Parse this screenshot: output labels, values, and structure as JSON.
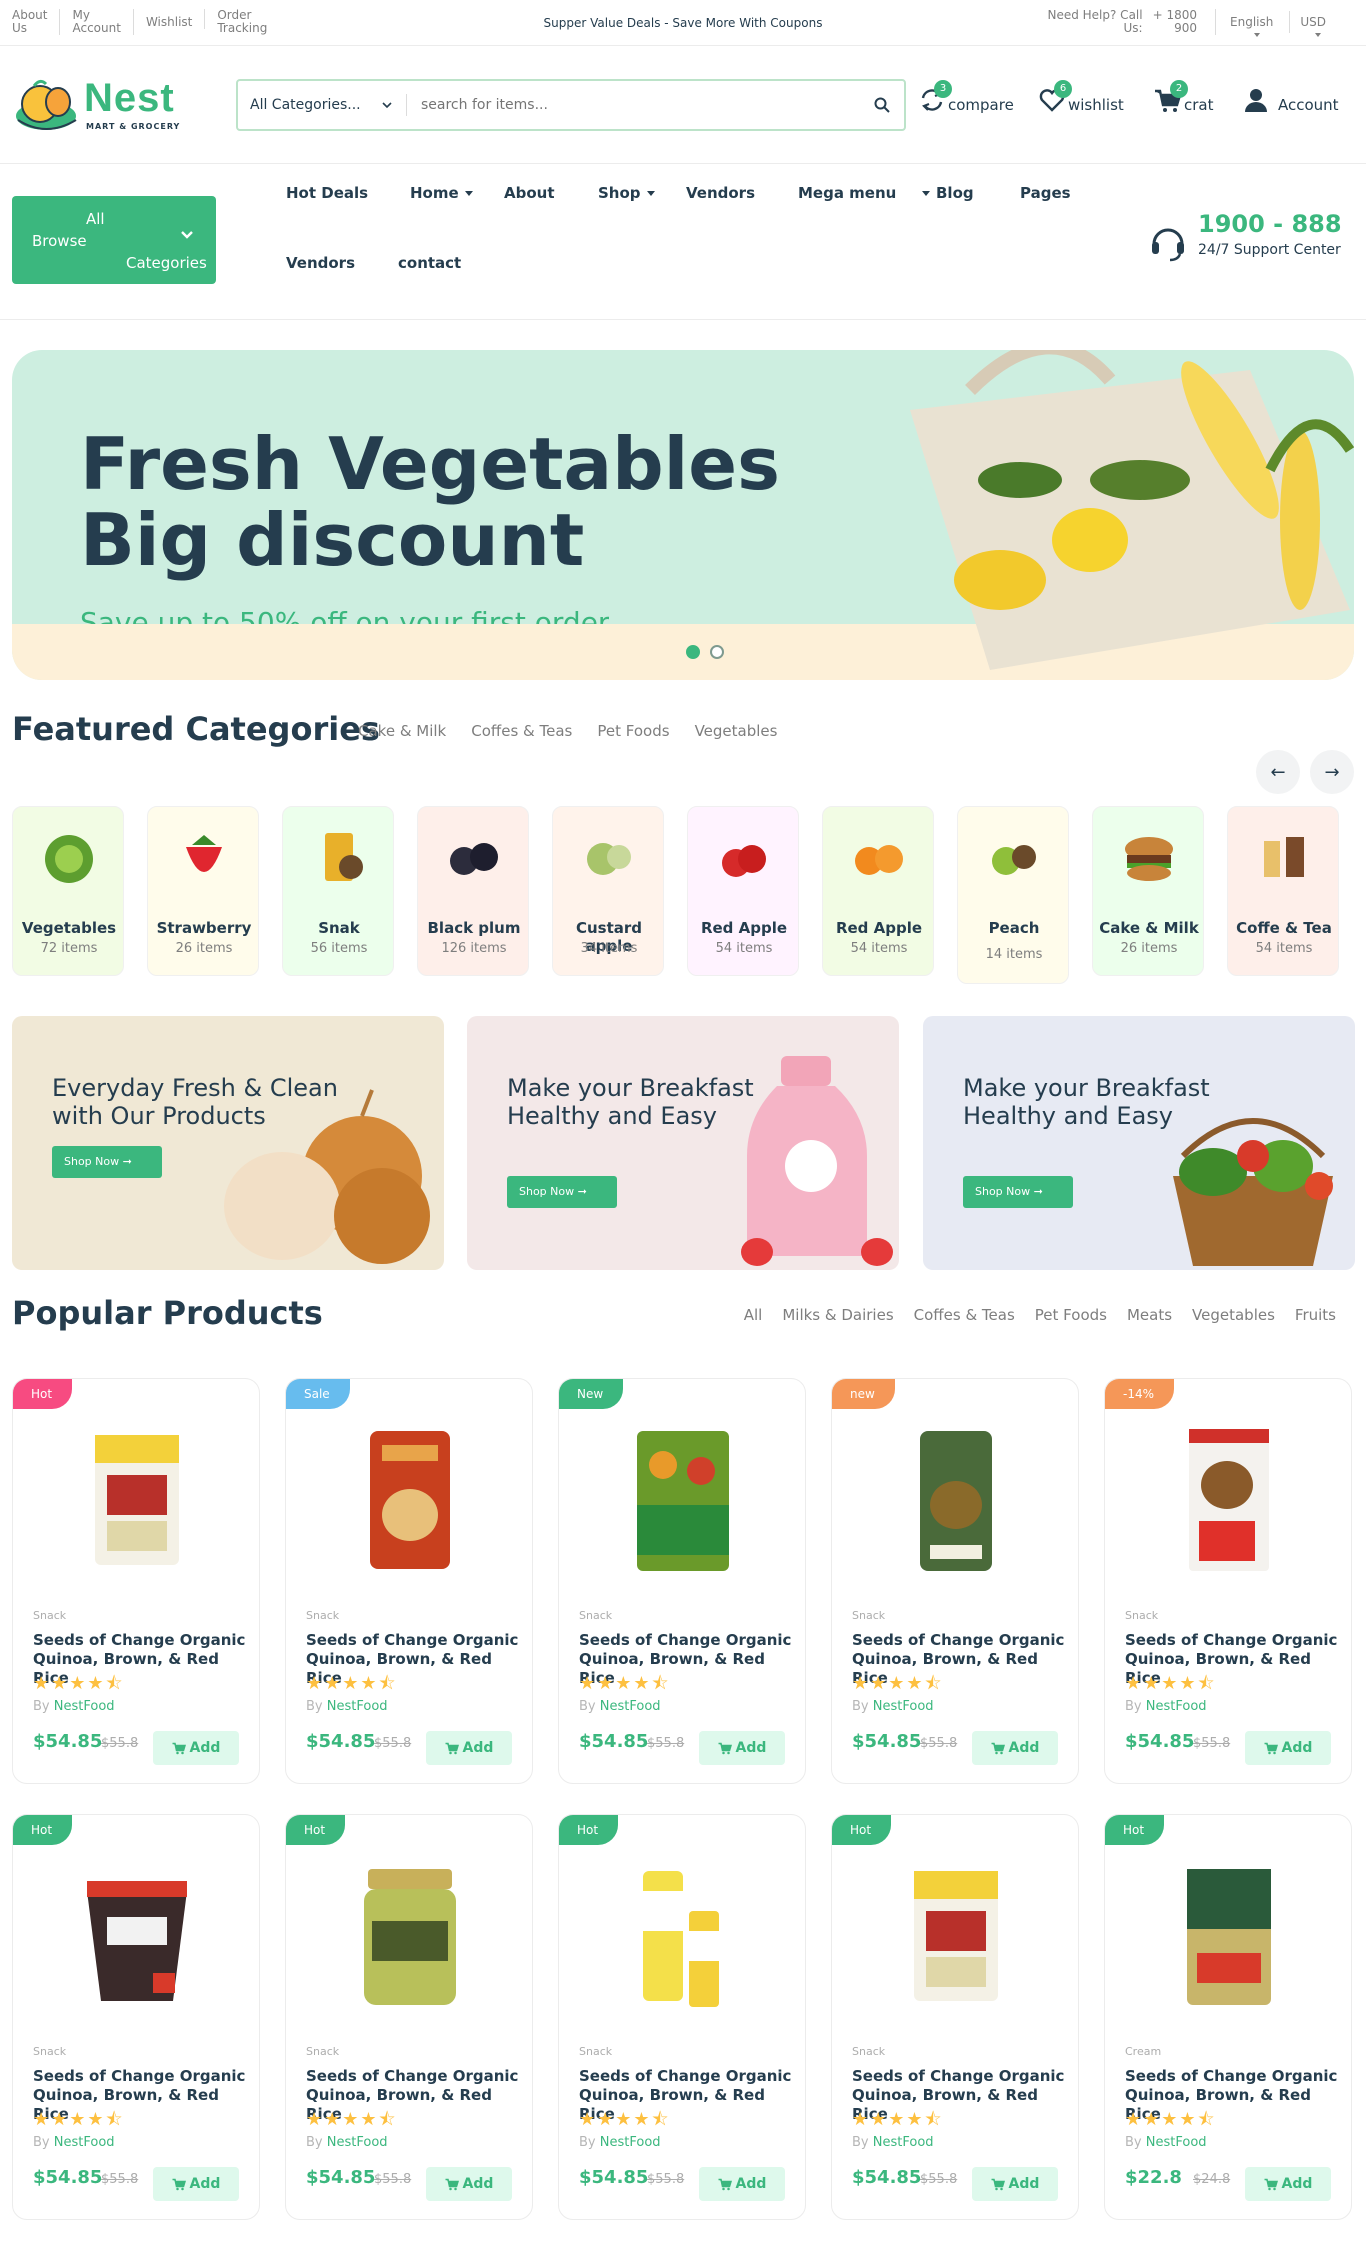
{
  "topbar": {
    "links": [
      {
        "l1": "About",
        "l2": "Us"
      },
      {
        "l1": "My",
        "l2": "Account"
      },
      {
        "l1": "Wishlist",
        "l2": ""
      },
      {
        "l1": "Order",
        "l2": "Tracking"
      }
    ],
    "promo": "Supper Value Deals - Save More With Coupons",
    "help_l1": "Need Help? Call",
    "help_l2": "Us:",
    "phone_l1": "+ 1800",
    "phone_l2": "900",
    "language": "English",
    "currency": "USD"
  },
  "header": {
    "logo_name": "Nest",
    "logo_tag": "MART & GROCERY",
    "category_select": "All Categories...",
    "search_placeholder": "search for items...",
    "compare": {
      "label": "compare",
      "count": "3"
    },
    "wishlist": {
      "label": "wishlist",
      "count": "6"
    },
    "cart": {
      "label": "crat",
      "count": "2"
    },
    "account": {
      "label": "Account"
    }
  },
  "nav": {
    "browse_l1": "All",
    "browse_l2": "Browse",
    "browse_l3": "Categories",
    "links": [
      "Hot Deals",
      "Home",
      "About",
      "Shop",
      "Vendors",
      "Mega menu",
      "Blog",
      "Pages",
      "Vendors",
      "contact"
    ],
    "support_number": "1900 - 888",
    "support_label": "24/7 Support Center"
  },
  "hero": {
    "line1": "Fresh Vegetables",
    "line2": "Big discount",
    "subtitle": "Save up to 50% off on your first order"
  },
  "featured": {
    "title": "Featured Categories",
    "tabs": [
      "Cake & Milk",
      "Coffes & Teas",
      "Pet Foods",
      "Vegetables"
    ],
    "prev_arrow": "←",
    "next_arrow": "→",
    "categories": [
      {
        "name": "Vegetables",
        "count": "72 items",
        "bg": "#f2fce4",
        "icon": "cabbage"
      },
      {
        "name": "Strawberry",
        "count": "26 items",
        "bg": "#fffceb",
        "icon": "strawberry"
      },
      {
        "name": "Snak",
        "count": "56 items",
        "bg": "#ecffec",
        "icon": "snack"
      },
      {
        "name": "Black plum",
        "count": "126 items",
        "bg": "#feefea",
        "icon": "plum"
      },
      {
        "name": "Custard apple",
        "count": "34 items",
        "bg": "#fff3eb",
        "icon": "custard-apple"
      },
      {
        "name": "Red Apple",
        "count": "54 items",
        "bg": "#fff3ff",
        "icon": "apple"
      },
      {
        "name": "Red Apple",
        "count": "54 items",
        "bg": "#f2fce4",
        "icon": "orange"
      },
      {
        "name": "Peach",
        "count": "14 items",
        "bg": "#fffceb",
        "icon": "kiwi"
      },
      {
        "name": "Cake & Milk",
        "count": "26 items",
        "bg": "#ecffec",
        "icon": "burger"
      },
      {
        "name": "Coffe & Tea",
        "count": "54 items",
        "bg": "#feefea",
        "icon": "coffee"
      }
    ]
  },
  "banners": [
    {
      "line1": "Everyday Fresh & Clean",
      "line2": "with Our Products",
      "button": "Shop Now ➞",
      "bg": "#f0e8d5"
    },
    {
      "line1": "Make your Breakfast",
      "line2": "Healthy and Easy",
      "button": "Shop Now ➞",
      "bg": "#f3e8e8"
    },
    {
      "line1": "Make your Breakfast",
      "line2": "Healthy and Easy",
      "button": "Shop Now ➞",
      "bg": "#e7eaf3"
    }
  ],
  "popular": {
    "title": "Popular Products",
    "tabs": [
      "All",
      "Milks & Dairies",
      "Coffes & Teas",
      "Pet Foods",
      "Meats",
      "Vegetables",
      "Fruits"
    ],
    "products": [
      {
        "tag": "Hot",
        "tag_color": "#f74b81",
        "category": "Snack",
        "name_l1": "Seeds of Change Organic",
        "name_l2": "Quinoa, Brown, & Red Rice",
        "stars": "★★★★⯪",
        "by": "By",
        "brand": "NestFood",
        "price": "$54.85",
        "old_price": "$55.8",
        "add": "Add",
        "img": "bag-yellow"
      },
      {
        "tag": "Sale",
        "tag_color": "#67bcee",
        "category": "Snack",
        "name_l1": "Seeds of Change Organic",
        "name_l2": "Quinoa, Brown, & Red Rice",
        "stars": "★★★★⯪",
        "by": "By",
        "brand": "NestFood",
        "price": "$54.85",
        "old_price": "$55.8",
        "add": "Add",
        "img": "bag-red"
      },
      {
        "tag": "New",
        "tag_color": "#3bb77e",
        "category": "Snack",
        "name_l1": "Seeds of Change Organic",
        "name_l2": "Quinoa, Brown, & Red Rice",
        "stars": "★★★★⯪",
        "by": "By",
        "brand": "NestFood",
        "price": "$54.85",
        "old_price": "$55.8",
        "add": "Add",
        "img": "bag-green-orange"
      },
      {
        "tag": "new",
        "tag_color": "#f59758",
        "category": "Snack",
        "name_l1": "Seeds of Change Organic",
        "name_l2": "Quinoa, Brown, & Red Rice",
        "stars": "★★★★⯪",
        "by": "By",
        "brand": "NestFood",
        "price": "$54.85",
        "old_price": "$55.8",
        "add": "Add",
        "img": "bag-olive"
      },
      {
        "tag": "-14%",
        "tag_color": "#f59758",
        "category": "Snack",
        "name_l1": "Seeds of Change Organic",
        "name_l2": "Quinoa, Brown, & Red Rice",
        "stars": "★★★★⯪",
        "by": "By",
        "brand": "NestFood",
        "price": "$54.85",
        "old_price": "$55.8",
        "add": "Add",
        "img": "bag-coconut"
      },
      {
        "tag": "Hot",
        "tag_color": "#3bb77e",
        "category": "Snack",
        "name_l1": "Seeds of Change Organic",
        "name_l2": "Quinoa, Brown, & Red Rice",
        "stars": "★★★★⯪",
        "by": "By",
        "brand": "NestFood",
        "price": "$54.85",
        "old_price": "$55.8",
        "add": "Add",
        "img": "cup-muffin"
      },
      {
        "tag": "Hot",
        "tag_color": "#3bb77e",
        "category": "Snack",
        "name_l1": "Seeds of Change Organic",
        "name_l2": "Quinoa, Brown, & Red Rice",
        "stars": "★★★★⯪",
        "by": "By",
        "brand": "NestFood",
        "price": "$54.85",
        "old_price": "$55.8",
        "add": "Add",
        "img": "jar-pistachio"
      },
      {
        "tag": "Hot",
        "tag_color": "#3bb77e",
        "category": "Snack",
        "name_l1": "Seeds of Change Organic",
        "name_l2": "Quinoa, Brown, & Red Rice",
        "stars": "★★★★⯪",
        "by": "By",
        "brand": "NestFood",
        "price": "$54.85",
        "old_price": "$55.8",
        "add": "Add",
        "img": "tube-yellow"
      },
      {
        "tag": "Hot",
        "tag_color": "#3bb77e",
        "category": "Snack",
        "name_l1": "Seeds of Change Organic",
        "name_l2": "Quinoa, Brown, & Red Rice",
        "stars": "★★★★⯪",
        "by": "By",
        "brand": "NestFood",
        "price": "$54.85",
        "old_price": "$55.8",
        "add": "Add",
        "img": "bag-yellow"
      },
      {
        "tag": "Hot",
        "tag_color": "#3bb77e",
        "category": "Cream",
        "name_l1": "Seeds of Change Organic",
        "name_l2": "Quinoa, Brown, & Red Rice",
        "stars": "★★★★⯪",
        "by": "By",
        "brand": "NestFood",
        "price": "$22.8",
        "old_price": "$24.8",
        "add": "Add",
        "img": "can-coffee"
      }
    ]
  }
}
